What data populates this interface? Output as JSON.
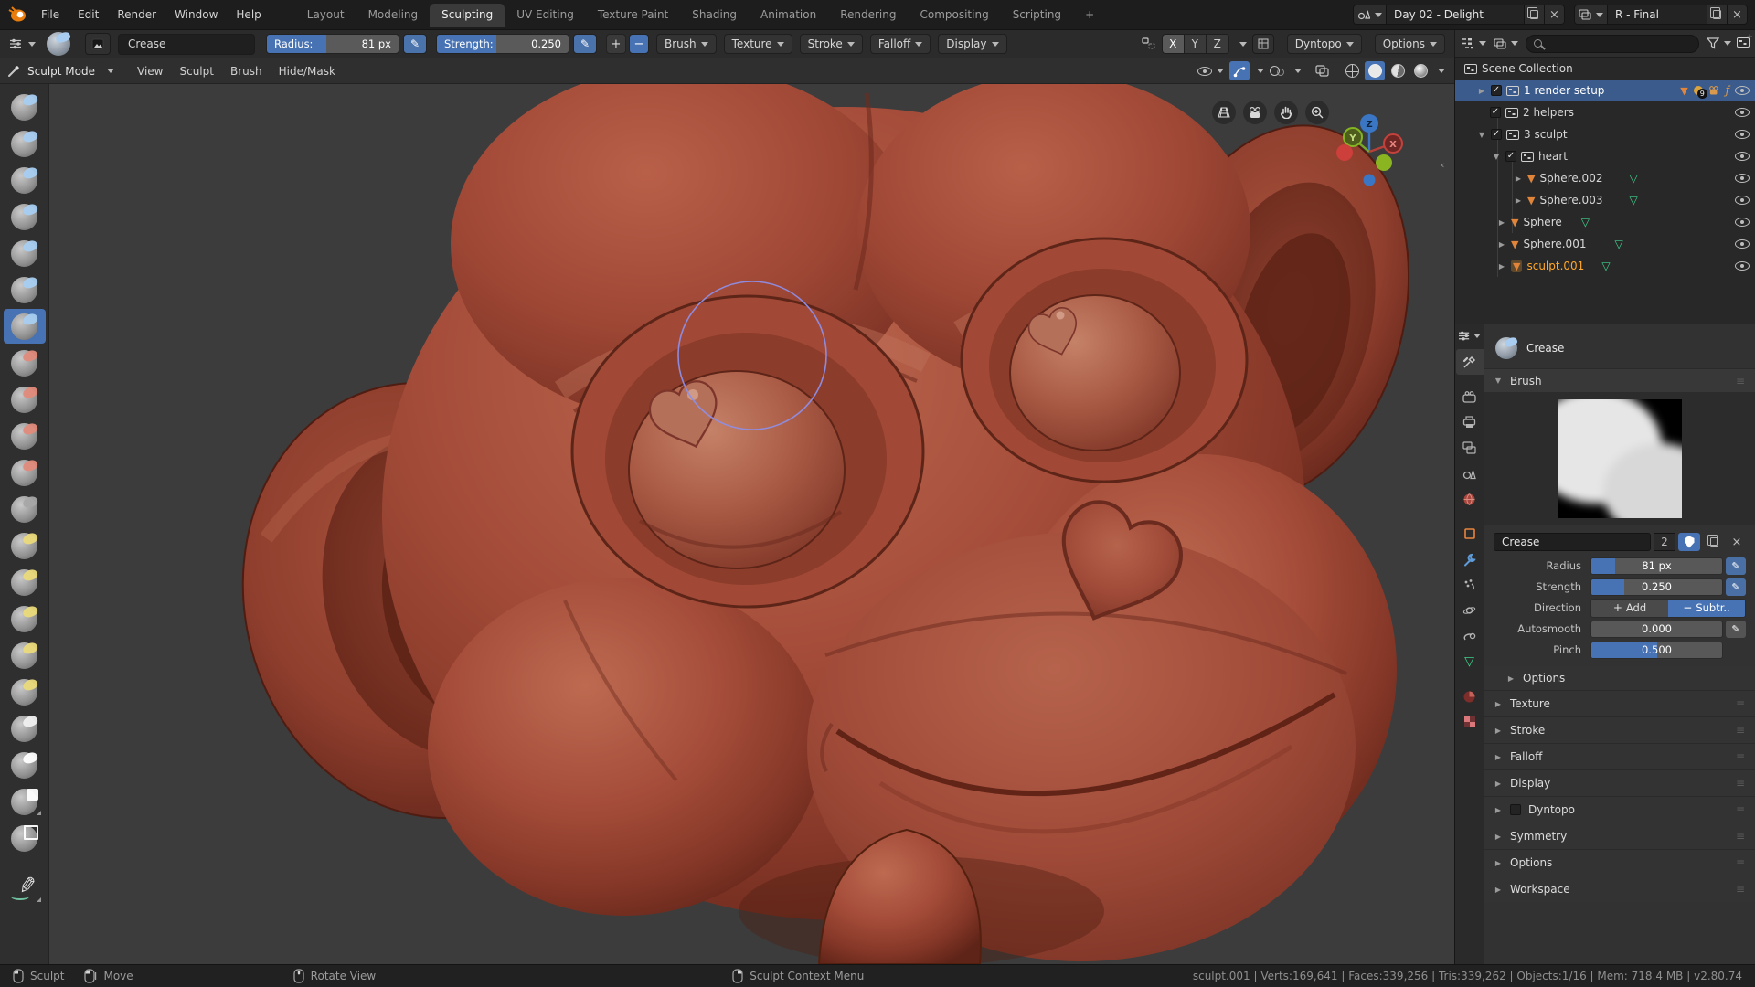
{
  "topbar": {
    "menus": [
      "File",
      "Edit",
      "Render",
      "Window",
      "Help"
    ],
    "tabs": [
      {
        "label": "Layout"
      },
      {
        "label": "Modeling"
      },
      {
        "label": "Sculpting",
        "cls": "active"
      },
      {
        "label": "UV Editing"
      },
      {
        "label": "Texture Paint"
      },
      {
        "label": "Shading"
      },
      {
        "label": "Animation"
      },
      {
        "label": "Rendering"
      },
      {
        "label": "Compositing"
      },
      {
        "label": "Scripting"
      },
      {
        "label": "+"
      }
    ],
    "scene": {
      "value": "Day 02 - Delight"
    },
    "view_layer": {
      "value": "R - Final"
    }
  },
  "tool_settings": {
    "brush_name": "Crease",
    "radius_label": "Radius:",
    "radius_value": "81 px",
    "strength_label": "Strength:",
    "strength_value": "0.250",
    "plus": "+",
    "minus": "−",
    "menus": [
      {
        "label": "Brush"
      },
      {
        "label": "Texture"
      },
      {
        "label": "Stroke"
      },
      {
        "label": "Falloff"
      },
      {
        "label": "Display"
      }
    ],
    "symmetry": [
      {
        "label": "X",
        "cls": "on"
      },
      {
        "label": "Y"
      },
      {
        "label": "Z"
      }
    ],
    "dyntopo_label": "Dyntopo",
    "options_label": "Options"
  },
  "viewport": {
    "mode": "Sculpt Mode",
    "menus": [
      {
        "label": "View"
      },
      {
        "label": "Sculpt"
      },
      {
        "label": "Brush"
      },
      {
        "label": "Hide/Mask"
      }
    ],
    "gizmo": {
      "x": "X",
      "y": "Y",
      "z": "Z"
    }
  },
  "toolbar": {
    "brushes": [
      {
        "name": "draw",
        "acc": "#a8cdf0"
      },
      {
        "name": "clay",
        "acc": "#a8cdf0"
      },
      {
        "name": "clay-strips",
        "acc": "#a8cdf0"
      },
      {
        "name": "layer",
        "acc": "#a8cdf0"
      },
      {
        "name": "inflate",
        "acc": "#a8cdf0"
      },
      {
        "name": "blob",
        "acc": "#a8cdf0"
      },
      {
        "name": "crease",
        "acc": "#a8cdf0",
        "cls": "sel"
      },
      {
        "name": "smooth",
        "acc": "#e08a7a"
      },
      {
        "name": "flatten",
        "acc": "#e08a7a"
      },
      {
        "name": "fill",
        "acc": "#e08a7a"
      },
      {
        "name": "scrape",
        "acc": "#e08a7a"
      },
      {
        "name": "pinch",
        "acc": "#a6a6a6"
      },
      {
        "name": "grab",
        "acc": "#ead97a"
      },
      {
        "name": "snake-hook",
        "acc": "#ead97a"
      },
      {
        "name": "thumb",
        "acc": "#ead97a"
      },
      {
        "name": "nudge",
        "acc": "#ead97a"
      },
      {
        "name": "rotate",
        "acc": "#ead97a"
      },
      {
        "name": "simplify",
        "acc": "#f0f0f0"
      },
      {
        "name": "mask",
        "acc": "#ffffff"
      },
      {
        "name": "box-mask",
        "acc": "#ffffff",
        "cls": "boxic"
      },
      {
        "name": "box-hide",
        "acc": "#ffffff",
        "cls": "boxic2"
      },
      {
        "name": "annotate",
        "acc": "#9fd8c0",
        "cls": "annot"
      }
    ]
  },
  "outliner": {
    "title": "Scene Collection",
    "rows": [
      {
        "label": "1 render setup",
        "badge": "9"
      },
      {
        "label": "2 helpers"
      },
      {
        "label": "3 sculpt"
      },
      {
        "label": "heart"
      },
      {
        "label": "Sphere.002"
      },
      {
        "label": "Sphere.003"
      },
      {
        "label": "Sphere"
      },
      {
        "label": "Sphere.001"
      },
      {
        "label": "sculpt.001"
      }
    ]
  },
  "properties": {
    "title": "Crease",
    "brush_panel_label": "Brush",
    "name_value": "Crease",
    "users_count": "2",
    "radius_label": "Radius",
    "radius_value": "81 px",
    "strength_label": "Strength",
    "strength_value": "0.250",
    "direction_label": "Direction",
    "direction_add": "Add",
    "direction_subtract": "Subtr..",
    "autosmooth_label": "Autosmooth",
    "autosmooth_value": "0.000",
    "pinch_label": "Pinch",
    "pinch_value": "0.500",
    "options_sub_label": "Options",
    "sections": [
      {
        "label": "Texture"
      },
      {
        "label": "Stroke"
      },
      {
        "label": "Falloff"
      },
      {
        "label": "Display"
      },
      {
        "label": "Dyntopo",
        "cls": "with-cb"
      },
      {
        "label": "Symmetry"
      },
      {
        "label": "Options"
      },
      {
        "label": "Workspace"
      }
    ]
  },
  "status_bar": {
    "hints": [
      {
        "label": "Sculpt",
        "button": "lmb"
      },
      {
        "label": "Move",
        "button": "lmb"
      },
      {
        "label": "Rotate View",
        "button": "mmb"
      },
      {
        "label": "Sculpt Context Menu",
        "button": "rmb"
      }
    ],
    "info": "sculpt.001 | Verts:169,641 | Faces:339,256 | Tris:339,262 | Objects:1/16 | Mem: 718.4 MB | v2.80.74"
  },
  "icons": {
    "search-icon": "magnifier circle+handle",
    "filter-icon": "funnel",
    "eye-icon": "visibility eye",
    "checkbox-icon": "checkmark box",
    "collection-icon": "box with dots",
    "mesh-icon": "orange triangle",
    "mesh-data-icon": "green triangle",
    "light-icon": "bulb",
    "camera-icon": "movie camera",
    "fcurve-icon": "ƒ",
    "pen-icon": "✎",
    "accent_blue": "#4772b3",
    "selection_blue": "#3b5b8c",
    "active_orange": "#ffa72b"
  }
}
